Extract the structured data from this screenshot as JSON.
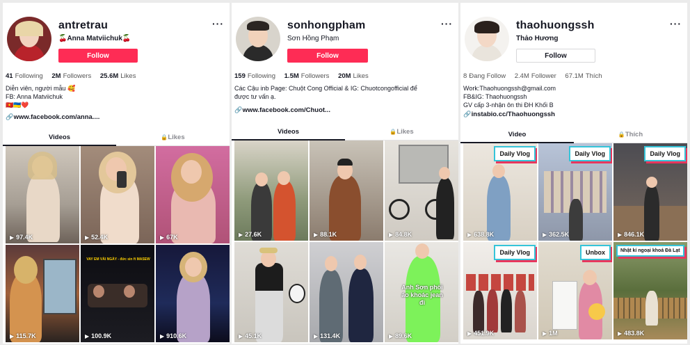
{
  "profiles": [
    {
      "handle": "antretrau",
      "display_name": "🍒Anna Matviichuk🍒",
      "follow_label": "Follow",
      "following_count": "41",
      "following_label": "Following",
      "followers_count": "2M",
      "followers_label": "Followers",
      "likes_count": "25.6M",
      "likes_label": "Likes",
      "bio_lines": [
        "Diễn viên, người mẫu 🥰",
        "FB: Anna Matviichuk",
        "🇻🇳🇺🇦❤️"
      ],
      "link": "www.facebook.com/anna....",
      "tab_videos": "Videos",
      "tab_likes": "Likes",
      "videos": [
        {
          "views": "97.4K"
        },
        {
          "views": "52.4K"
        },
        {
          "views": "67K"
        },
        {
          "views": "115.7K"
        },
        {
          "views": "100.9K",
          "caption": "VAY EM VÀI NGÀY - đức sin ft MASEW"
        },
        {
          "views": "910.6K"
        }
      ]
    },
    {
      "handle": "sonhongpham",
      "display_name": "Sơn Hồng Phạm",
      "follow_label": "Follow",
      "following_count": "159",
      "following_label": "Following",
      "followers_count": "1.5M",
      "followers_label": "Followers",
      "likes_count": "20M",
      "likes_label": "Likes",
      "bio_lines": [
        "Các Cậu inb Page: Chuột Cong Official & IG: Chuotcongofficial để",
        "được tư vấn ạ."
      ],
      "link": "www.facebook.com/Chuot...",
      "tab_videos": "Videos",
      "tab_likes": "Likes",
      "videos": [
        {
          "views": "27.6K"
        },
        {
          "views": "88.1K"
        },
        {
          "views": "84.8K"
        },
        {
          "views": "45.1K"
        },
        {
          "views": "131.4K"
        },
        {
          "views": "89.6K",
          "overlay": "Anh Sơn phối áo khoác jean đi"
        }
      ]
    },
    {
      "handle": "thaohuongssh",
      "display_name": "Thảo Hương",
      "follow_label": "Follow",
      "following_count": "8",
      "following_label": "Đang Follow",
      "followers_count": "2.4M",
      "followers_label": "Follower",
      "likes_count": "67.1M",
      "likes_label": "Thích",
      "bio_lines": [
        "Work:Thaohuongssh@gmail.com",
        "FB&IG: Thaohuongssh",
        "GV cấp 3-nhận ôn thi ĐH Khối B"
      ],
      "link": "instabio.cc/Thaohuongssh",
      "tab_videos": "Video",
      "tab_likes": "Thích",
      "videos": [
        {
          "views": "638.8K",
          "badge": "Daily Vlog"
        },
        {
          "views": "362.5K",
          "badge": "Daily Vlog"
        },
        {
          "views": "846.1K",
          "badge": "Daily Vlog"
        },
        {
          "views": "451.9K",
          "badge": "Daily Vlog"
        },
        {
          "views": "1M",
          "badge": "Unbox"
        },
        {
          "views": "483.8K",
          "badge": "Nhật kí ngoại khoá Đà Lạt"
        }
      ]
    }
  ],
  "icons": {
    "more": "more-horizontal-icon",
    "link": "link-icon",
    "lock": "lock-icon",
    "play": "play-icon"
  },
  "colors": {
    "follow_red": "#fe2c55",
    "badge_border": "#35c4d9",
    "badge_shadow": "#e8365d"
  }
}
